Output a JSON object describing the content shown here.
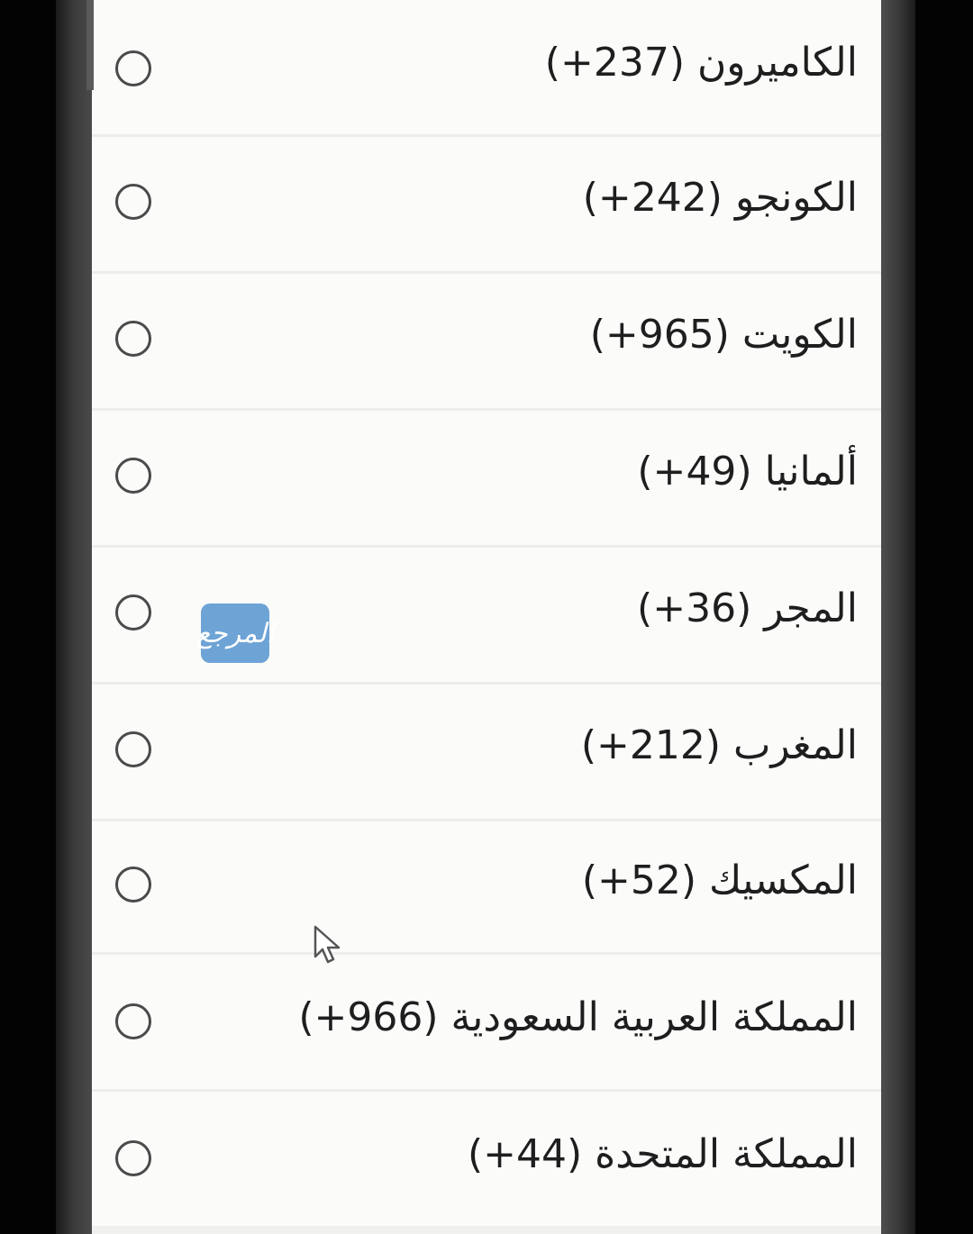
{
  "country_picker": {
    "items": [
      {
        "label": "الكاميرون (237+)",
        "selected": false
      },
      {
        "label": "الكونجو (242+)",
        "selected": false
      },
      {
        "label": "الكويت (965+)",
        "selected": false
      },
      {
        "label": "ألمانيا (49+)",
        "selected": false
      },
      {
        "label": "المجر (36+)",
        "selected": false
      },
      {
        "label": "المغرب (212+)",
        "selected": false
      },
      {
        "label": "المكسيك (52+)",
        "selected": false
      },
      {
        "label": "المملكة العربية السعودية (966+)",
        "selected": false
      },
      {
        "label": "المملكة المتحدة (44+)",
        "selected": false
      }
    ]
  },
  "watermark": {
    "text": "المرجع"
  },
  "icons": {
    "radio": "radio-button-unchecked-icon",
    "cursor": "mouse-pointer-icon"
  },
  "colors": {
    "background": "#030303",
    "dialog": "#fbfcfa",
    "text": "#1e1e1e",
    "radio_border": "#4a4a4a",
    "divider": "#eceeec",
    "watermark": "#6ea3d6"
  }
}
